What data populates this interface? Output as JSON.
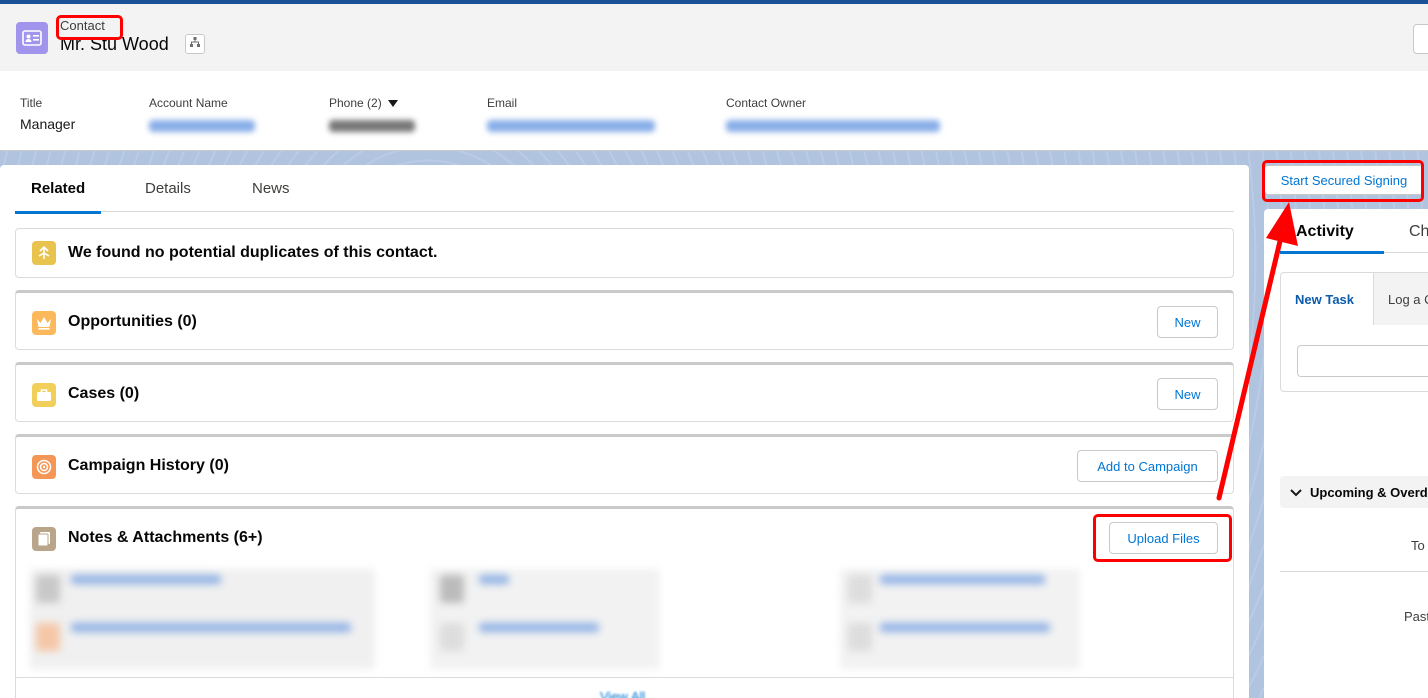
{
  "header": {
    "object_label": "Contact",
    "record_name": "Mr. Stu Wood",
    "fields": [
      {
        "label": "Title",
        "value": "Manager"
      },
      {
        "label": "Account Name",
        "value": ""
      },
      {
        "label": "Phone (2)",
        "value": ""
      },
      {
        "label": "Email",
        "value": ""
      },
      {
        "label": "Contact Owner",
        "value": ""
      }
    ]
  },
  "tabs": {
    "related": "Related",
    "details": "Details",
    "news": "News"
  },
  "cards": {
    "duplicates": {
      "title": "We found no potential duplicates of this contact."
    },
    "opportunities": {
      "title": "Opportunities (0)",
      "button": "New"
    },
    "cases": {
      "title": "Cases (0)",
      "button": "New"
    },
    "campaign_history": {
      "title": "Campaign History (0)",
      "button": "Add to Campaign"
    },
    "notes_attachments": {
      "title": "Notes & Attachments (6+)",
      "button": "Upload Files",
      "view_all": "View All"
    }
  },
  "right_panel": {
    "start_button": "Start Secured Signing",
    "activity_tab": "Activity",
    "chatter_tab": "Ch",
    "new_task": "New Task",
    "log_a_call": "Log a C",
    "upcoming": "Upcoming & Overd",
    "to_label": "To",
    "past_label": "Past"
  },
  "colors": {
    "contact_icon": "#a094ed",
    "duplicates_icon": "#e8c44e",
    "opportunities_icon": "#fcb95b",
    "cases_icon": "#f2cf5b",
    "campaign_icon": "#f49756",
    "notes_icon": "#b9a589",
    "brand_blue": "#0176d3",
    "annotation_red": "#ff0000"
  },
  "icons": {
    "contact": "contact-card-icon",
    "hierarchy": "hierarchy-icon",
    "duplicates": "merge-icon",
    "opportunities": "crown-icon",
    "cases": "briefcase-icon",
    "campaign": "target-icon",
    "notes": "document-icon",
    "chevron": "chevron-down-icon"
  }
}
